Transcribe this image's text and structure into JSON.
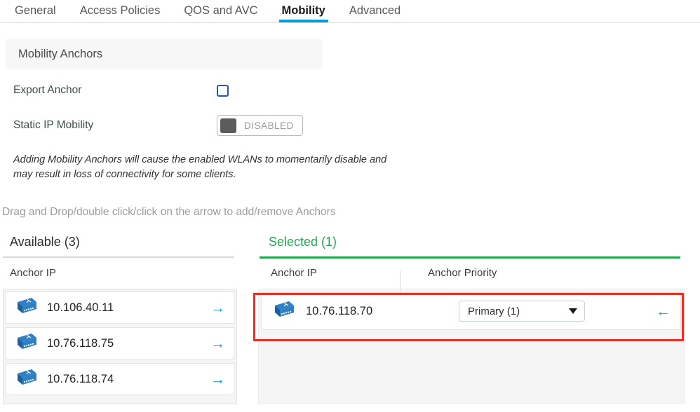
{
  "tabs": [
    {
      "label": "General",
      "active": false
    },
    {
      "label": "Access Policies",
      "active": false
    },
    {
      "label": "QOS and AVC",
      "active": false
    },
    {
      "label": "Mobility",
      "active": true
    },
    {
      "label": "Advanced",
      "active": false
    }
  ],
  "section": {
    "title": "Mobility Anchors"
  },
  "form": {
    "export_anchor_label": "Export Anchor",
    "export_anchor_checked": false,
    "static_ip_label": "Static IP Mobility",
    "static_ip_state": "DISABLED"
  },
  "warning_text": "Adding Mobility Anchors will cause the enabled WLANs to momentarily disable and may result in loss of connectivity for some clients.",
  "hint_text": "Drag and Drop/double click/click on the arrow to add/remove Anchors",
  "available": {
    "title": "Available (3)",
    "column_header": "Anchor IP",
    "items": [
      {
        "ip": "10.106.40.11",
        "arrow": "→"
      },
      {
        "ip": "10.76.118.75",
        "arrow": "→"
      },
      {
        "ip": "10.76.118.74",
        "arrow": "→"
      }
    ]
  },
  "selected": {
    "title": "Selected (1)",
    "column_header_ip": "Anchor IP",
    "column_header_priority": "Anchor Priority",
    "items": [
      {
        "ip": "10.76.118.70",
        "priority": "Primary (1)",
        "arrow": "←"
      }
    ]
  },
  "colors": {
    "active_tab_accent": "#049fd9",
    "selected_green": "#21a84c",
    "arrow_blue": "#1a9bd7",
    "checkbox_blue": "#2b54b5",
    "annotation_red": "#ee2d24"
  }
}
